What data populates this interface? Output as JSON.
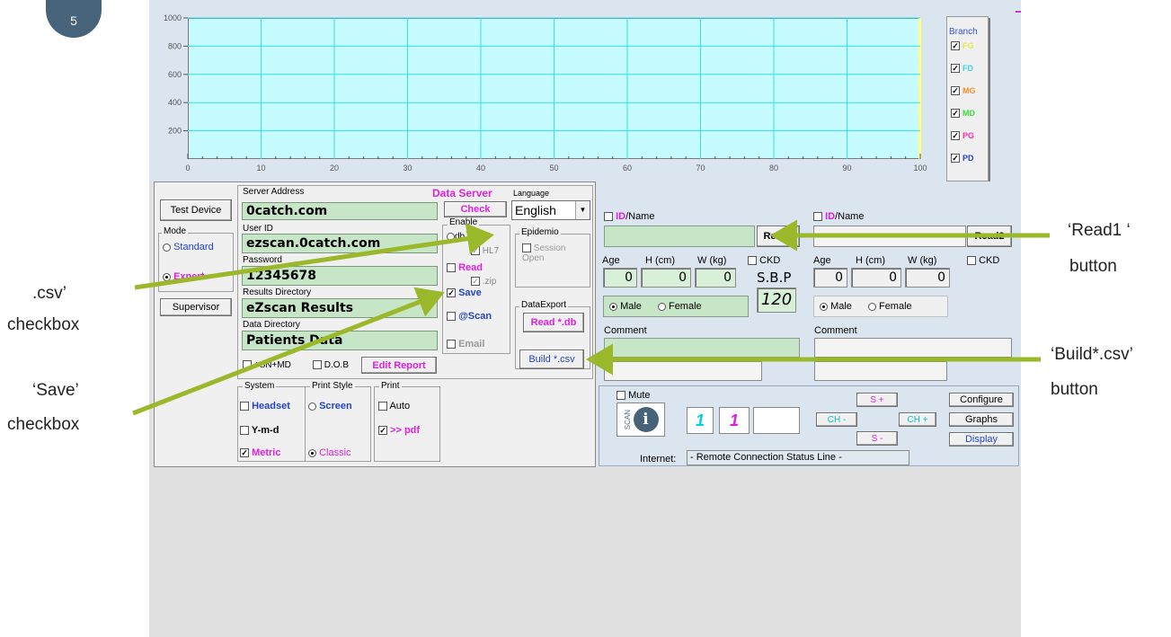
{
  "slide_number": "5",
  "chart_data": {
    "type": "line",
    "series": [],
    "x_ticks": [
      "0",
      "10",
      "20",
      "30",
      "40",
      "50",
      "60",
      "70",
      "80",
      "90",
      "100"
    ],
    "y_ticks": [
      "1000",
      "800",
      "600",
      "400",
      "200"
    ],
    "xlim": [
      0,
      100
    ],
    "ylim": [
      0,
      1000
    ],
    "grid": true,
    "background": "#c6fbff",
    "grid_color": "#34e0ee"
  },
  "branch": {
    "title": "Branch",
    "items": [
      {
        "label": "FG",
        "color": "#e8e84a",
        "checked": true
      },
      {
        "label": "FD",
        "color": "#34d6ee",
        "checked": true
      },
      {
        "label": "MG",
        "color": "#ff8a2a",
        "checked": true
      },
      {
        "label": "MD",
        "color": "#33dd33",
        "checked": true
      },
      {
        "label": "PG",
        "color": "#ff2aa8",
        "checked": true
      },
      {
        "label": "PD",
        "color": "#2244cc",
        "checked": true
      }
    ]
  },
  "left": {
    "test_device": "Test Device",
    "mode_label": "Mode",
    "mode_standard": "Standard",
    "mode_expert": "Expert",
    "supervisor": "Supervisor",
    "server_address_label": "Server Address",
    "server_address": "0catch.com",
    "data_server": "Data Server",
    "check": "Check",
    "language_label": "Language",
    "language": "English",
    "user_id_label": "User ID",
    "user_id": "ezscan.0catch.com",
    "password_label": "Password",
    "password": "12345678",
    "results_dir_label": "Results Directory",
    "results_dir": "eZscan Results",
    "data_dir_label": "Data Directory",
    "data_dir": "Patients Data",
    "sn_md": "+SN+MD",
    "dob": "D.O.B",
    "edit_report": "Edit Report",
    "enable_label": "Enable",
    "enable_db": "db",
    "enable_hl7": "HL7",
    "enable_read": "Read",
    "enable_zip": ".zip",
    "enable_save": "Save",
    "enable_atscan": "@Scan",
    "enable_email": "Email",
    "epidemio_label": "Epidemio",
    "session_open": "Session Open",
    "data_export_label": "DataExport",
    "read_db": "Read *.db",
    "build_csv": "Build *.csv",
    "system_label": "System",
    "headset": "Headset",
    "ymd": "Y-m-d",
    "metric": "Metric",
    "print_style_label": "Print Style",
    "screen": "Screen",
    "classic": "Classic",
    "print_label": "Print",
    "auto": "Auto",
    "pdf": ">> pdf"
  },
  "patient1": {
    "id_prefix": "ID",
    "name_suffix": "/Name",
    "read_button": "Read1",
    "age_label": "Age",
    "h_label": "H (cm)",
    "w_label": "W (kg)",
    "age": "0",
    "h": "0",
    "w": "0",
    "ckd": "CKD",
    "sbp_label": "S.B.P",
    "sbp": "120",
    "male": "Male",
    "female": "Female",
    "comment_label": "Comment"
  },
  "patient2": {
    "id_prefix": "ID",
    "name_suffix": "/Name",
    "read_button": "Read2",
    "age_label": "Age",
    "h_label": "H (cm)",
    "w_label": "W (kg)",
    "age": "0",
    "h": "0",
    "w": "0",
    "ckd": "CKD",
    "male": "Male",
    "female": "Female",
    "comment_label": "Comment"
  },
  "bottom": {
    "mute": "Mute",
    "scan_label": "SCAN",
    "counter1": "1",
    "counter2": "1",
    "s_plus": "S +",
    "s_minus": "S -",
    "ch_minus": "CH -",
    "ch_plus": "CH +",
    "configure": "Configure",
    "graphs": "Graphs",
    "display": "Display",
    "internet_label": "Internet:",
    "status_line": "- Remote Connection Status Line -"
  },
  "annotations": {
    "read1_a": "‘Read1 ‘",
    "read1_b": "button",
    "csv_a": ".csv’",
    "csv_b": "checkbox",
    "build_a": "‘Build*.csv’",
    "build_b": "button",
    "save_a": "‘Save’",
    "save_b": "checkbox"
  },
  "colors": {
    "arrow": "#9ab82a",
    "magenta": "#e020e0",
    "field_green": "#c7e5c7",
    "panel_blue": "#dbe5ef"
  }
}
